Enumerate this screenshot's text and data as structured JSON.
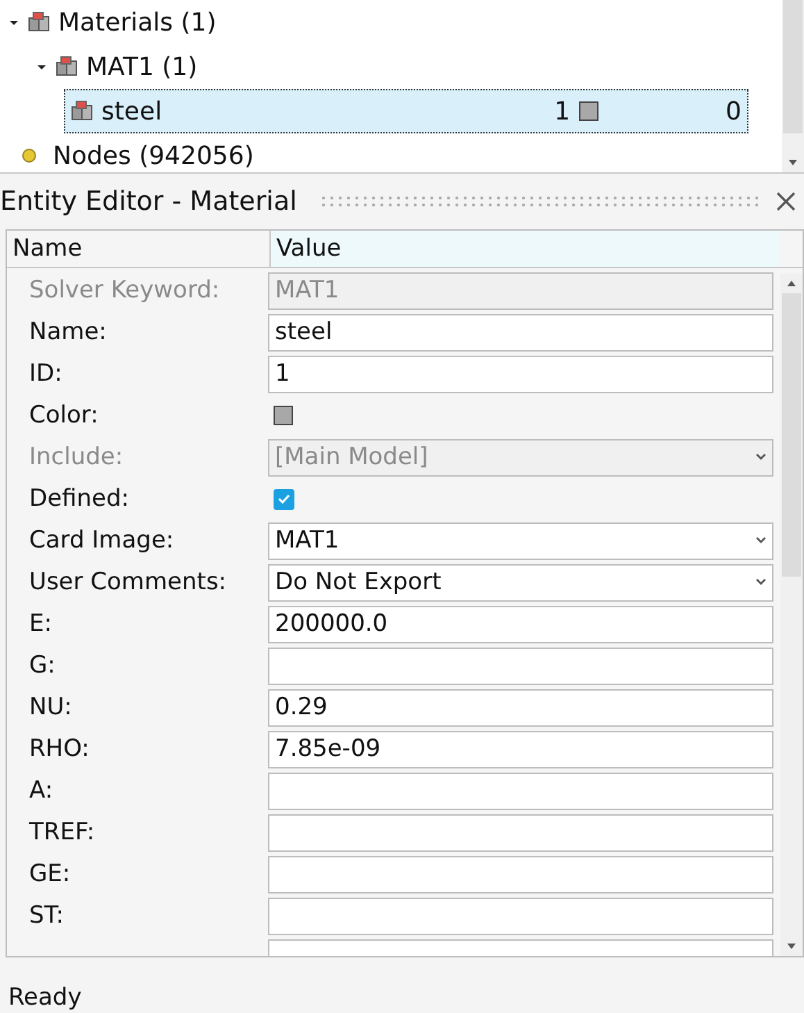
{
  "tree": [
    {
      "label": "Materials (1)",
      "kind": "group",
      "expanded": true,
      "children": [
        {
          "label": "MAT1 (1)",
          "kind": "group",
          "expanded": true,
          "children": [
            {
              "label": "steel",
              "kind": "material",
              "selected": true,
              "id": "1",
              "count": "0"
            }
          ]
        }
      ]
    },
    {
      "label": "Nodes (942056)",
      "kind": "nodes"
    }
  ],
  "editor": {
    "title": "Entity Editor - Material",
    "columns": [
      "Name",
      "Value"
    ],
    "rows": [
      {
        "label": "Solver Keyword:",
        "kind": "text",
        "value": "MAT1",
        "disabled": true
      },
      {
        "label": "Name:",
        "kind": "text",
        "value": "steel",
        "disabled": false
      },
      {
        "label": "ID:",
        "kind": "text",
        "value": "1",
        "disabled": false
      },
      {
        "label": "Color:",
        "kind": "color",
        "color": "#a8a8a8"
      },
      {
        "label": "Include:",
        "kind": "select",
        "value": "[Main Model]",
        "disabled": true
      },
      {
        "label": "Defined:",
        "kind": "checkbox",
        "checked": true
      },
      {
        "label": "Card Image:",
        "kind": "select",
        "value": "MAT1",
        "disabled": false
      },
      {
        "label": "User Comments:",
        "kind": "select",
        "value": "Do Not Export",
        "disabled": false
      },
      {
        "label": "E:",
        "kind": "text",
        "value": "200000.0",
        "disabled": false
      },
      {
        "label": "G:",
        "kind": "text",
        "disabled": false
      },
      {
        "label": "NU:",
        "kind": "text",
        "value": "0.29",
        "disabled": false
      },
      {
        "label": "RHO:",
        "kind": "text",
        "value": "7.85e-09",
        "disabled": false
      },
      {
        "label": "A:",
        "kind": "text",
        "disabled": false
      },
      {
        "label": "TREF:",
        "kind": "text",
        "disabled": false
      },
      {
        "label": "GE:",
        "kind": "text",
        "disabled": false
      },
      {
        "label": "ST:",
        "kind": "text",
        "disabled": false
      },
      {
        "kind": "text",
        "disabled": false
      }
    ]
  },
  "status_bar": {
    "text": "Ready"
  }
}
